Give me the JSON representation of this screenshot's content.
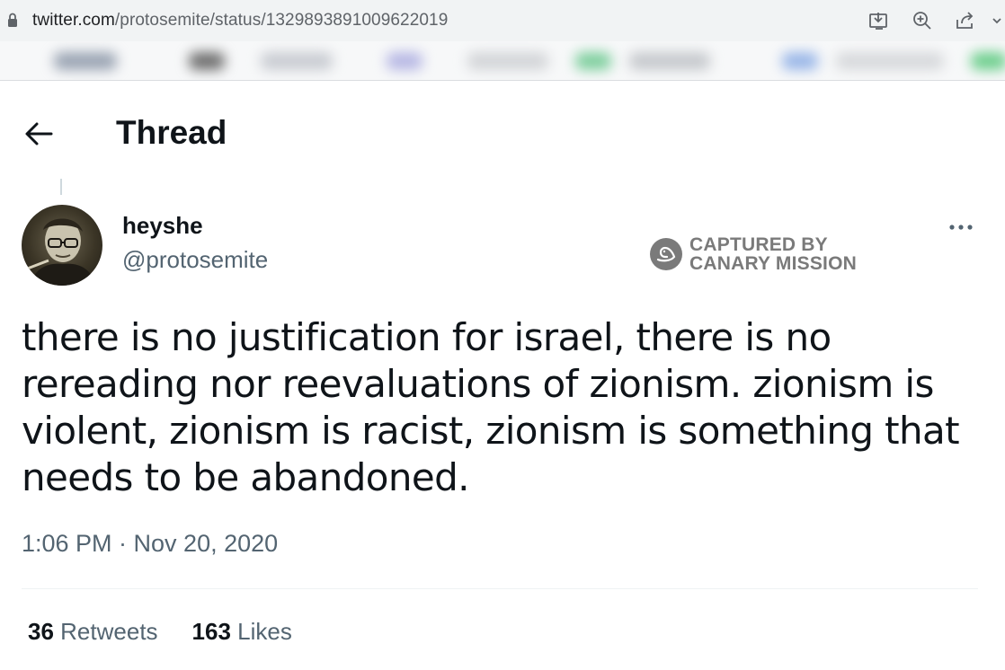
{
  "browser": {
    "url_domain": "twitter.com",
    "url_path": "/protosemite/status/1329893891009622019"
  },
  "header": {
    "title": "Thread"
  },
  "tweet": {
    "display_name": "heyshe",
    "handle": "@protosemite",
    "text": "there is no justification for israel, there is no rereading nor reevaluations of zionism. zionism is violent, zionism is racist, zionism is something that needs to be abandoned.",
    "timestamp": "1:06 PM · Nov 20, 2020",
    "retweets_count": "36",
    "retweets_label": "Retweets",
    "likes_count": "163",
    "likes_label": "Likes"
  },
  "watermark": {
    "line1": "CAPTURED BY",
    "line2": "CANARY MISSION"
  },
  "colors": {
    "text_primary": "#0f1419",
    "text_secondary": "#536471",
    "watermark": "#7a7a7a"
  }
}
